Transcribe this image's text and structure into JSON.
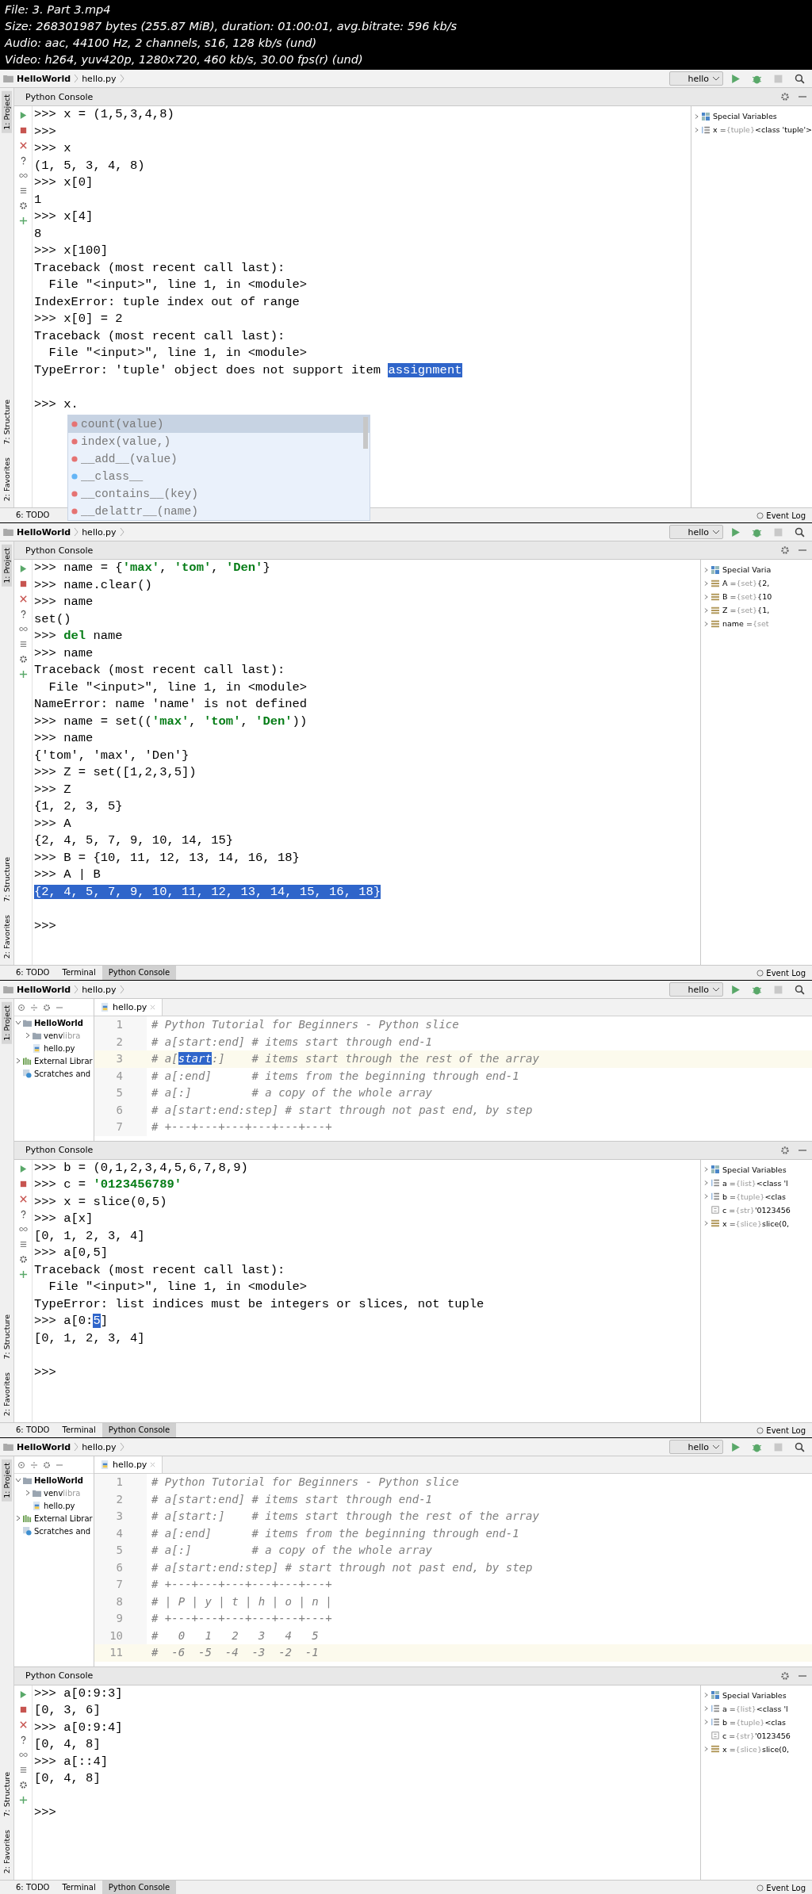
{
  "video_info": [
    "File: 3. Part 3.mp4",
    "Size: 268301987 bytes (255.87 MiB), duration: 01:00:01, avg.bitrate: 596 kb/s",
    "Audio: aac, 44100 Hz, 2 channels, s16, 128 kb/s (und)",
    "Video: h264, yuv420p, 1280x720, 460 kb/s, 30.00 fps(r) (und)"
  ],
  "frames": [
    {
      "breadcrumb": [
        "HelloWorld",
        "hello.py"
      ],
      "run_config": "hello",
      "strip_top": [
        {
          "label": "1: Project",
          "selected": true
        }
      ],
      "strip_bottom": [
        {
          "label": "7: Structure",
          "selected": false
        },
        {
          "label": "2: Favorites",
          "selected": false
        }
      ],
      "console": {
        "title": "Python Console",
        "lines": [
          {
            "text": ">>> x = (1,5,3,4,8)"
          },
          {
            "text": ">>>"
          },
          {
            "text": ">>> x"
          },
          {
            "text": "(1, 5, 3, 4, 8)"
          },
          {
            "text": ">>> x[0]"
          },
          {
            "text": "1"
          },
          {
            "text": ">>> x[4]"
          },
          {
            "text": "8"
          },
          {
            "text": ">>> x[100]"
          },
          {
            "text": "Traceback (most recent call last):"
          },
          {
            "text": "  File \"<input>\", line 1, in <module>"
          },
          {
            "text": "IndexError: tuple index out of range"
          },
          {
            "text": ">>> x[0] = 2"
          },
          {
            "text": "Traceback (most recent call last):"
          },
          {
            "text": "  File \"<input>\", line 1, in <module>"
          },
          {
            "text": "TypeError: 'tuple' object does not support item ",
            "selected_text": "assignment"
          },
          {
            "text": ">>> x."
          }
        ]
      },
      "completion": [
        {
          "label": "count(value)",
          "kind": "method",
          "selected": true
        },
        {
          "label": "index(value,)",
          "kind": "method",
          "selected": false
        },
        {
          "label": "__add__(value)",
          "kind": "method",
          "selected": false
        },
        {
          "label": "__class__",
          "kind": "field",
          "selected": false
        },
        {
          "label": "__contains__(key)",
          "kind": "method",
          "selected": false
        },
        {
          "label": "__delattr__(name)",
          "kind": "method",
          "selected": false
        }
      ],
      "variables": [
        {
          "name": "Special Variables",
          "kind": "special",
          "expandable": true
        },
        {
          "name": "x =",
          "type": "{tuple}",
          "value": "<class 'tuple'>",
          "kind": "sequence",
          "expandable": true
        }
      ],
      "bottom_tabs": [
        {
          "label": "6: TODO",
          "selected": false
        }
      ],
      "event_log": "Event Log"
    },
    {
      "breadcrumb": [
        "HelloWorld",
        "hello.py"
      ],
      "run_config": "hello",
      "strip_top": [
        {
          "label": "1: Project",
          "selected": true
        }
      ],
      "strip_bottom": [
        {
          "label": "7: Structure",
          "selected": false
        },
        {
          "label": "2: Favorites",
          "selected": false
        }
      ],
      "console": {
        "title": "Python Console",
        "lines": [
          {
            "text": ">>> name = {**'max'**, **'tom'**, **'Den'**}"
          },
          {
            "text": ">>> name.clear()"
          },
          {
            "text": ">>> name"
          },
          {
            "text": "set()"
          },
          {
            "text": ">>> **del** name"
          },
          {
            "text": ">>> name"
          },
          {
            "text": "Traceback (most recent call last):"
          },
          {
            "text": "  File \"<input>\", line 1, in <module>"
          },
          {
            "text": "NameError: name 'name' is not defined"
          },
          {
            "text": ">>> name = set((**'max'**, **'tom'**, **'Den'**))"
          },
          {
            "text": ">>> name"
          },
          {
            "text": "{'tom', 'max', 'Den'}"
          },
          {
            "text": ">>> Z = set([1,2,3,5])"
          },
          {
            "text": ">>> Z"
          },
          {
            "text": "{1, 2, 3, 5}"
          },
          {
            "text": ">>> A"
          },
          {
            "text": "{2, 4, 5, 7, 9, 10, 14, 15}"
          },
          {
            "text": ">>> B = {10, 11, 12, 13, 14, 16, 18}"
          },
          {
            "text": ">>> A | B"
          },
          {
            "selected_text": "{2, 4, 5, 7, 9, 10, 11, 12, 13, 14, 15, 16, 18}"
          },
          {
            "text": ">>>"
          }
        ]
      },
      "variables": [
        {
          "name": "Special Varia",
          "kind": "special",
          "expandable": true
        },
        {
          "name": "A =",
          "type": "{set}",
          "value": "{2,",
          "kind": "object",
          "expandable": true
        },
        {
          "name": "B =",
          "type": "{set}",
          "value": "{10",
          "kind": "object",
          "expandable": true
        },
        {
          "name": "Z =",
          "type": "{set}",
          "value": "{1,",
          "kind": "object",
          "expandable": true
        },
        {
          "name": "name =",
          "type": "{set",
          "kind": "object",
          "expandable": true
        }
      ],
      "bottom_tabs": [
        {
          "label": "6: TODO",
          "selected": false
        },
        {
          "label": "Terminal",
          "selected": false
        },
        {
          "label": "Python Console",
          "selected": true
        }
      ],
      "event_log": "Event Log"
    },
    {
      "breadcrumb": [
        "HelloWorld",
        "hello.py"
      ],
      "run_config": "hello",
      "strip_top": [
        {
          "label": "1: Project",
          "selected": true
        }
      ],
      "strip_bottom": [
        {
          "label": "7: Structure",
          "selected": false
        },
        {
          "label": "2: Favorites",
          "selected": false
        }
      ],
      "project_tree": [
        {
          "label": "HelloWorld",
          "kind": "folder",
          "expanded": true,
          "children": [
            {
              "label": "venv",
              "note": "libra",
              "kind": "folder",
              "expanded": false
            },
            {
              "label": "hello.py",
              "kind": "file"
            }
          ]
        },
        {
          "label": "External Librar",
          "kind": "library",
          "expanded": false
        },
        {
          "label": "Scratches and",
          "kind": "scratch"
        }
      ],
      "editor": {
        "tab": "hello.py",
        "lines": [
          {
            "num": "1",
            "text": "# Python Tutorial for Beginners - Python slice",
            "current": false
          },
          {
            "num": "2",
            "text": "# a[start:end] # items start through end-1",
            "current": false
          },
          {
            "num": "3",
            "text": "# a[",
            "selected_text": "start",
            "after": ":]    # items start through the rest of the array",
            "current": true
          },
          {
            "num": "4",
            "text": "# a[:end]      # items from the beginning through end-1",
            "current": false
          },
          {
            "num": "5",
            "text": "# a[:]         # a copy of the whole array",
            "current": false
          },
          {
            "num": "6",
            "text": "# a[start:end:step] # start through not past end, by step",
            "current": false
          },
          {
            "num": "7",
            "text": "# +---+---+---+---+---+---+",
            "current": false
          }
        ]
      },
      "console": {
        "title": "Python Console",
        "lines": [
          {
            "text": ">>> b = (0,1,2,3,4,5,6,7,8,9)"
          },
          {
            "text": ">>> c = **'0123456789'**"
          },
          {
            "text": ">>> x = slice(0,5)"
          },
          {
            "text": ">>> a[x]"
          },
          {
            "text": "[0, 1, 2, 3, 4]"
          },
          {
            "text": ">>> a[0,5]"
          },
          {
            "text": "Traceback (most recent call last):"
          },
          {
            "text": "  File \"<input>\", line 1, in <module>"
          },
          {
            "text": "TypeError: list indices must be integers or slices, not tuple"
          },
          {
            "text": ">>> a[0:",
            "selected_text": "5",
            "after": "]"
          },
          {
            "text": "[0, 1, 2, 3, 4]"
          },
          {
            "text": ">>>"
          }
        ]
      },
      "variables": [
        {
          "name": "Special Variables",
          "kind": "special",
          "expandable": true
        },
        {
          "name": "a =",
          "type": "{list}",
          "value": "<class 'l",
          "kind": "sequence",
          "expandable": true
        },
        {
          "name": "b =",
          "type": "{tuple}",
          "value": "<clas",
          "kind": "sequence",
          "expandable": true
        },
        {
          "name": "c =",
          "type": "{str}",
          "value": "'0123456",
          "kind": "string",
          "expandable": false
        },
        {
          "name": "x =",
          "type": "{slice}",
          "value": "slice(0,",
          "kind": "object",
          "expandable": true
        }
      ],
      "bottom_tabs": [
        {
          "label": "6: TODO",
          "selected": false
        },
        {
          "label": "Terminal",
          "selected": false
        },
        {
          "label": "Python Console",
          "selected": true
        }
      ],
      "event_log": "Event Log"
    },
    {
      "breadcrumb": [
        "HelloWorld",
        "hello.py"
      ],
      "run_config": "hello",
      "strip_top": [
        {
          "label": "1: Project",
          "selected": true
        }
      ],
      "strip_bottom": [
        {
          "label": "7: Structure",
          "selected": false
        },
        {
          "label": "2: Favorites",
          "selected": false
        }
      ],
      "project_tree": [
        {
          "label": "HelloWorld",
          "kind": "folder",
          "expanded": true,
          "children": [
            {
              "label": "venv",
              "note": "libra",
              "kind": "folder",
              "expanded": false
            },
            {
              "label": "hello.py",
              "kind": "file"
            }
          ]
        },
        {
          "label": "External Librar",
          "kind": "library",
          "expanded": false
        },
        {
          "label": "Scratches and",
          "kind": "scratch"
        }
      ],
      "editor": {
        "tab": "hello.py",
        "lines": [
          {
            "num": "1",
            "text": "# Python Tutorial for Beginners - Python slice",
            "current": false
          },
          {
            "num": "2",
            "text": "# a[start:end] # items start through end-1",
            "current": false
          },
          {
            "num": "3",
            "text": "# a[start:]    # items start through the rest of the array",
            "current": false
          },
          {
            "num": "4",
            "text": "# a[:end]      # items from the beginning through end-1",
            "current": false
          },
          {
            "num": "5",
            "text": "# a[:]         # a copy of the whole array",
            "current": false
          },
          {
            "num": "6",
            "text": "# a[start:end:step] # start through not past end, by step",
            "current": false
          },
          {
            "num": "7",
            "text": "# +---+---+---+---+---+---+",
            "current": false
          },
          {
            "num": "8",
            "text": "# | P | y | t | h | o | n |",
            "current": false
          },
          {
            "num": "9",
            "text": "# +---+---+---+---+---+---+",
            "current": false
          },
          {
            "num": "10",
            "text": "#   0   1   2   3   4   5",
            "current": false
          },
          {
            "num": "11",
            "text": "#  -6  -5  -4  -3  -2  -1",
            "current": true
          }
        ]
      },
      "console": {
        "title": "Python Console",
        "lines": [
          {
            "text": ">>> a[0:9:3]"
          },
          {
            "text": "[0, 3, 6]"
          },
          {
            "text": ">>> a[0:9:4]"
          },
          {
            "text": "[0, 4, 8]"
          },
          {
            "text": ">>> a[::4]"
          },
          {
            "text": "[0, 4, 8]"
          },
          {
            "text": ">>>"
          }
        ]
      },
      "variables": [
        {
          "name": "Special Variables",
          "kind": "special",
          "expandable": true
        },
        {
          "name": "a =",
          "type": "{list}",
          "value": "<class 'l",
          "kind": "sequence",
          "expandable": true
        },
        {
          "name": "b =",
          "type": "{tuple}",
          "value": "<clas",
          "kind": "sequence",
          "expandable": true
        },
        {
          "name": "c =",
          "type": "{str}",
          "value": "'0123456",
          "kind": "string",
          "expandable": false
        },
        {
          "name": "x =",
          "type": "{slice}",
          "value": "slice(0,",
          "kind": "object",
          "expandable": true
        }
      ],
      "bottom_tabs": [
        {
          "label": "6: TODO",
          "selected": false
        },
        {
          "label": "Terminal",
          "selected": false
        },
        {
          "label": "Python Console",
          "selected": true
        }
      ],
      "event_log": "Event Log"
    }
  ]
}
